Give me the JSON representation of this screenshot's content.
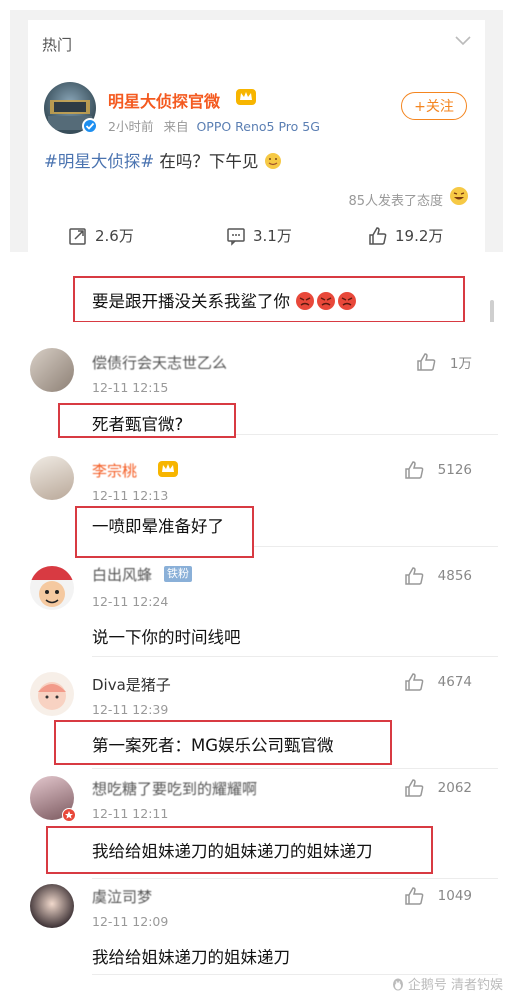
{
  "hot_card": {
    "section_title": "热门",
    "author": "明星大侦探官微",
    "time": "2小时前",
    "source_prefix": "来自",
    "device": "OPPO Reno5 Pro 5G",
    "follow_label": "+关注",
    "post_hashtag": "#明星大侦探#",
    "post_text": " 在吗？下午见",
    "reaction_text": "85人发表了态度",
    "actions": {
      "repost": "2.6万",
      "comment": "3.1万",
      "like": "19.2万"
    }
  },
  "annotation_top": "要是跟开播没关系我鲨了你",
  "comments": [
    {
      "name": "偿债行会天志世乙么",
      "time": "12-11 12:15",
      "likes": "1万",
      "body": "死者甄官微?"
    },
    {
      "name": "李宗桃",
      "time": "12-11 12:13",
      "likes": "5126",
      "body": "一喷即晕准备好了"
    },
    {
      "name": "白出风蜂",
      "badge": "铁粉",
      "time": "12-11 12:24",
      "likes": "4856",
      "body": "说一下你的时间线吧"
    },
    {
      "name": "Diva是猪子",
      "time": "12-11 12:39",
      "likes": "4674",
      "body": "第一案死者：MG娱乐公司甄官微"
    },
    {
      "name": "想吃糖了要吃到的耀耀啊",
      "time": "12-11 12:11",
      "likes": "2062",
      "body": "我给给姐妹递刀的姐妹递刀的姐妹递刀"
    },
    {
      "name": "虞泣司梦",
      "time": "12-11 12:09",
      "likes": "1049",
      "body": "我给给姐妹递刀的姐妹递刀"
    }
  ],
  "watermark": "企鹅号 清者钓娱",
  "colors": {
    "accent_orange": "#f4851f",
    "author_orange": "#f45a20",
    "link_blue": "#4a73b0",
    "annotation_red": "#d83a42",
    "verify_blue": "#1e8ff0"
  }
}
